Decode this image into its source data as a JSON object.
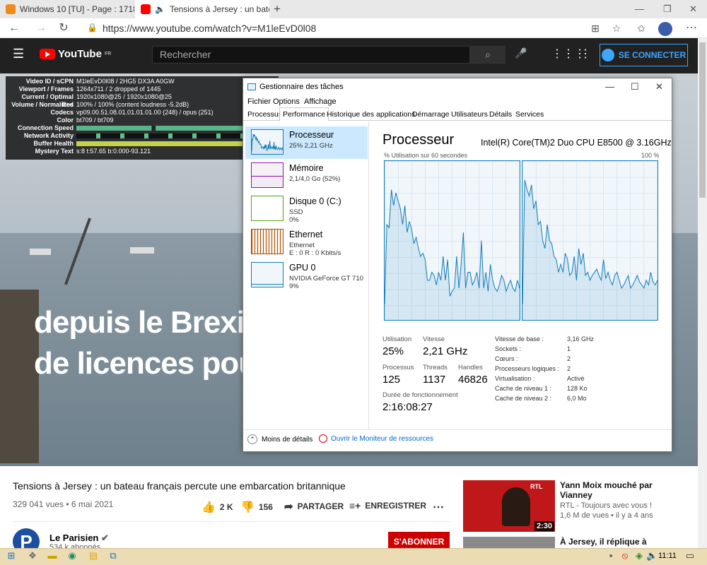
{
  "browser": {
    "tabs": [
      {
        "label": "Windows 10 [TU] - Page : 1718 ..."
      },
      {
        "label": "Tensions à Jersey : un bateau..."
      }
    ],
    "url": "https://www.youtube.com/watch?v=M1leEvD0l08"
  },
  "youtube": {
    "logo": "YouTube",
    "logo_region": "FR",
    "search_placeholder": "Rechercher",
    "signin": "SE CONNECTER",
    "caption_lines": [
      "depuis le Brexit",
      "de licences pou"
    ],
    "stats": [
      {
        "k": "Video ID / sCPN",
        "v": "M1leEvD0l08 / 2HG5 DX3A A0GW"
      },
      {
        "k": "Viewport / Frames",
        "v": "1264x711 / 2 dropped of 1445"
      },
      {
        "k": "Current / Optimal Res",
        "v": "1920x1080@25 / 1920x1080@25"
      },
      {
        "k": "Volume / Normalized",
        "v": "100% / 100% (content loudness -5.2dB)"
      },
      {
        "k": "Codecs",
        "v": "vp09.00.51.08.01.01.01.01.00 (248) / opus (251)"
      },
      {
        "k": "Color",
        "v": "bt709 / bt709"
      },
      {
        "k": "Connection Speed",
        "v": ""
      },
      {
        "k": "Network Activity",
        "v": ""
      },
      {
        "k": "Buffer Health",
        "v": ""
      },
      {
        "k": "Mystery Text",
        "v": "s:8 t:57.65 b:0.000-93.121"
      }
    ],
    "title": "Tensions à Jersey : un bateau français percute une embarcation britannique",
    "meta": "329 041 vues • 6 mai 2021",
    "likes": "2 K",
    "dislikes": "156",
    "share": "PARTAGER",
    "save": "ENREGISTRER",
    "channel": "Le Parisien",
    "subscribers": "534 k abonnés",
    "avatar_letter": "P",
    "subscribe": "S'ABONNER",
    "related": [
      {
        "title": "Yann Moix mouché par Vianney",
        "channel": "RTL - Toujours avec vous !",
        "meta": "1,6 M de vues • il y a 4 ans",
        "duration": "2:30",
        "badge": "RTL"
      },
      {
        "title": "À Jersey, il réplique à"
      }
    ]
  },
  "taskmanager": {
    "title": "Gestionnaire des tâches",
    "menus": [
      "Fichier",
      "Options",
      "Affichage"
    ],
    "tabs": [
      "Processus",
      "Performance",
      "Historique des applications",
      "Démarrage",
      "Utilisateurs",
      "Détails",
      "Services"
    ],
    "items": [
      {
        "name": "Processeur",
        "sub": "25% 2,21 GHz",
        "color": "#117dbb"
      },
      {
        "name": "Mémoire",
        "sub": "2,1/4,0 Go (52%)",
        "color": "#8b12ae"
      },
      {
        "name": "Disque 0 (C:)",
        "sub": "SSD",
        "sub2": "0%",
        "color": "#4da60c"
      },
      {
        "name": "Ethernet",
        "sub": "Ethernet",
        "sub2": "E : 0 R : 0 Kbits/s",
        "color": "#a74f01"
      },
      {
        "name": "GPU 0",
        "sub": "NVIDIA GeForce GT 710",
        "sub2": "9%",
        "color": "#117dbb"
      }
    ],
    "heading": "Processeur",
    "model": "Intel(R) Core(TM)2 Duo CPU E8500 @ 3.16GHz",
    "graph_label": "% Utilisation sur 60 secondes",
    "graph_max": "100 %",
    "stats": [
      {
        "label": "Utilisation",
        "value": "25%"
      },
      {
        "label": "Vitesse",
        "value": "2,21 GHz"
      },
      {
        "label": "Processus",
        "value": "125"
      },
      {
        "label": "Threads",
        "value": "1137"
      },
      {
        "label": "Handles",
        "value": "46826"
      },
      {
        "label": "Durée de fonctionnement",
        "value": "2:16:08:27"
      }
    ],
    "props": [
      {
        "k": "Vitesse de base :",
        "v": "3,16 GHz"
      },
      {
        "k": "Sockets :",
        "v": "1"
      },
      {
        "k": "Cœurs :",
        "v": "2"
      },
      {
        "k": "Processeurs logiques :",
        "v": "2"
      },
      {
        "k": "Virtualisation :",
        "v": "Activé"
      },
      {
        "k": "Cache de niveau 1 :",
        "v": "128 Ko"
      },
      {
        "k": "Cache de niveau 2 :",
        "v": "6,0 Mo"
      }
    ],
    "less_details": "Moins de détails",
    "resource_monitor": "Ouvrir le Moniteur de ressources",
    "core_series": [
      [
        10,
        60,
        58,
        82,
        72,
        80,
        75,
        70,
        60,
        72,
        55,
        62,
        57,
        48,
        52,
        45,
        40,
        42,
        38,
        25,
        25,
        30,
        28,
        22,
        30,
        25,
        40,
        25,
        38,
        15,
        18,
        20,
        40,
        20,
        35,
        55,
        20,
        30,
        30,
        22,
        25,
        30,
        20,
        50,
        20,
        30,
        18,
        35,
        25,
        20,
        18,
        22,
        28,
        25,
        18,
        22,
        25,
        20,
        18,
        25,
        20
      ],
      [
        10,
        88,
        82,
        78,
        85,
        70,
        75,
        60,
        62,
        50,
        45,
        60,
        50,
        48,
        40,
        38,
        30,
        35,
        30,
        42,
        38,
        28,
        30,
        40,
        25,
        45,
        35,
        42,
        28,
        30,
        25,
        28,
        30,
        32,
        28,
        25,
        38,
        26,
        30,
        25,
        22,
        28,
        30,
        25,
        20,
        22,
        25,
        28,
        20,
        22,
        25,
        28,
        24,
        22,
        20,
        25,
        22,
        30,
        24,
        22,
        25
      ]
    ]
  },
  "taskbar": {
    "time": "11:11"
  }
}
